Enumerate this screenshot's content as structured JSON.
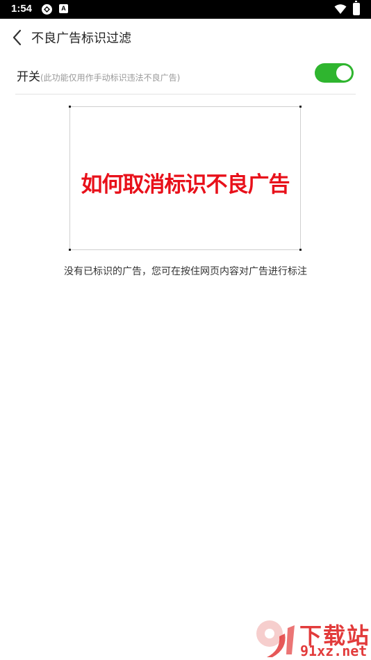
{
  "status_bar": {
    "time": "1:54",
    "app_badge": "A"
  },
  "header": {
    "title": "不良广告标识过滤"
  },
  "filter_switch": {
    "label": "开关",
    "note": "(此功能仅用作手动标识违法不良广告)",
    "enabled": true,
    "on_color": "#2fb52f"
  },
  "banner": {
    "text": "如何取消标识不良广告",
    "text_color": "#e8101a"
  },
  "empty_state": {
    "message": "没有已标识的广告，您可在按住网页内容对广告进行标注"
  },
  "watermark": {
    "mark": "9",
    "title": "下载站",
    "domain": "91xz.net",
    "color": "#e23b3b"
  }
}
